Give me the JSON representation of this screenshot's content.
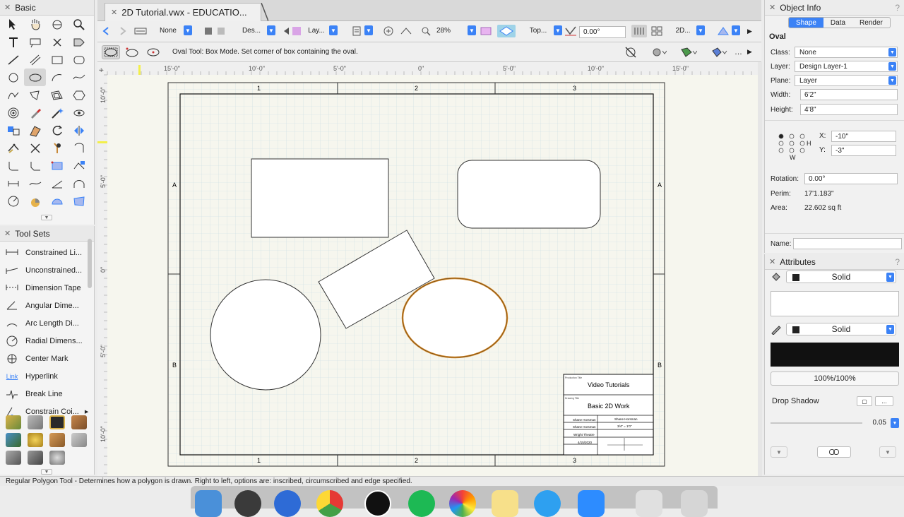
{
  "basic_panel": {
    "title": "Basic",
    "tools": [
      "select",
      "pan",
      "flyover",
      "zoom",
      "text",
      "callout",
      "delete",
      "tag",
      "line",
      "double-line",
      "rectangle",
      "rounded-rectangle",
      "circle",
      "oval",
      "arc",
      "freehand",
      "polyline",
      "polygon",
      "double-polygon",
      "regular-polygon",
      "spiral",
      "eyedropper",
      "wand",
      "visibility",
      "connect",
      "attribute",
      "rotate",
      "mirror",
      "trim",
      "split",
      "offset",
      "clip",
      "fillet",
      "chamfer",
      "reshape",
      "push-pull",
      "dimension",
      "chain-dimension",
      "angle",
      "section",
      "protractor",
      "pie",
      "cloud",
      "poly-area"
    ]
  },
  "toolsets": {
    "title": "Tool Sets",
    "items": [
      {
        "label": "Constrained Li...",
        "icon": "constrained-linear-icon"
      },
      {
        "label": "Unconstrained...",
        "icon": "unconstrained-icon"
      },
      {
        "label": "Dimension Tape",
        "icon": "dimension-tape-icon"
      },
      {
        "label": "Angular Dime...",
        "icon": "angular-dimension-icon"
      },
      {
        "label": "Arc Length Di...",
        "icon": "arc-length-icon"
      },
      {
        "label": "Radial Dimens...",
        "icon": "radial-dimension-icon"
      },
      {
        "label": "Center Mark",
        "icon": "center-mark-icon"
      },
      {
        "label": "Hyperlink",
        "icon": "hyperlink-icon"
      },
      {
        "label": "Break Line",
        "icon": "break-line-icon"
      },
      {
        "label": "Constrain Coi...",
        "icon": "constrain-coincident-icon"
      }
    ],
    "hyperlink_glyph": "Link"
  },
  "tab": {
    "title": "2D Tutorial.vwx - EDUCATIO..."
  },
  "view_bar": {
    "class_value": "None",
    "layer_value": "Des...",
    "layer2_value": "Lay...",
    "zoom": "28%",
    "view": "Top...",
    "rotation": "0.00°",
    "render": "2D..."
  },
  "mode_bar": {
    "message": "Oval Tool: Box Mode. Set corner of box containing the oval."
  },
  "rulers": {
    "top": [
      "15'-0\"",
      "10'-0\"",
      "5'-0\"",
      "0\"",
      "5'-0\"",
      "10'-0\"",
      "15'-0\""
    ],
    "left": [
      "10'-0\"",
      "5'-0\"",
      "0\"",
      "5'-0\"",
      "10'-0\""
    ]
  },
  "sheet": {
    "cols": [
      "1",
      "2",
      "3"
    ],
    "rows": [
      "A",
      "B"
    ]
  },
  "title_block": {
    "production_title_label": "Production Title",
    "production_title": "Video Tutorials",
    "drawing_title_label": "Drawing Title",
    "drawing_title": "Basic 2D Work",
    "designer": "Shane Horsman",
    "drawn_by": "Shane Horsman",
    "scale": "3/4\" = 1'0\"",
    "venue": "Wright Theatre",
    "date": "4/15/2020"
  },
  "object_info": {
    "title": "Object Info",
    "tabs": [
      "Shape",
      "Data",
      "Render"
    ],
    "object_type": "Oval",
    "class_label": "Class:",
    "class_value": "None",
    "layer_label": "Layer:",
    "layer_value": "Design Layer-1",
    "plane_label": "Plane:",
    "plane_value": "Layer",
    "width_label": "Width:",
    "width_value": "6'2\"",
    "height_label": "Height:",
    "height_value": "4'8\"",
    "x_label": "X:",
    "x_value": "-10\"",
    "y_label": "Y:",
    "y_value": "-3\"",
    "h_label": "H",
    "w_label": "W",
    "rotation_label": "Rotation:",
    "rotation_value": "0.00°",
    "perim_label": "Perim:",
    "perim_value": "17'1.183\"",
    "area_label": "Area:",
    "area_value": "22.602 sq ft",
    "name_label": "Name:",
    "name_value": ""
  },
  "attributes": {
    "title": "Attributes",
    "fill_style": "Solid",
    "pen_style": "Solid",
    "opacity": "100%/100%",
    "drop_shadow_label": "Drop Shadow",
    "drop_shadow_more": "...",
    "line_weight": "0.05"
  },
  "status_bar": {
    "message": "Regular Polygon Tool - Determines how a polygon is drawn.  Right to left, options are: inscribed, circumscribed and edge specified."
  },
  "colors": {
    "accent": "#3b82f6",
    "selection": "#d2882a",
    "grid": "#c9dde3",
    "paper": "#f6f6ee"
  }
}
